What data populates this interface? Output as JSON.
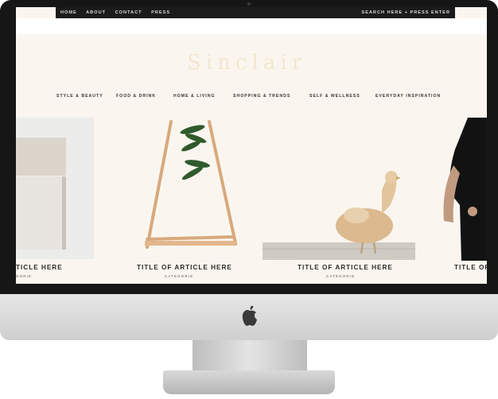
{
  "topbar": {
    "nav": [
      "HOME",
      "ABOUT",
      "CONTACT",
      "PRESS"
    ],
    "search": "SEARCH HERE + PRESS ENTER"
  },
  "logo_text": "Sinclair",
  "categories": [
    "STYLE & BEAUTY",
    "FOOD & DRINK",
    "HOME & LIVING",
    "SHOPPING & TRENDS",
    "SELF & WELLNESS",
    "EVERYDAY INSPIRATION"
  ],
  "cards": [
    {
      "title": "TICLE HERE",
      "category": "GORIE"
    },
    {
      "title": "TITLE OF ARTICLE HERE",
      "category": "CATEGORIE"
    },
    {
      "title": "TITLE OF ARTICLE HERE",
      "category": "CATEGORIE"
    },
    {
      "title": "TITLE OF",
      "category": ""
    }
  ],
  "colors": {
    "bezel": "#161616",
    "page_bg": "#faf6ef",
    "topbar": "#1b1b1b"
  }
}
